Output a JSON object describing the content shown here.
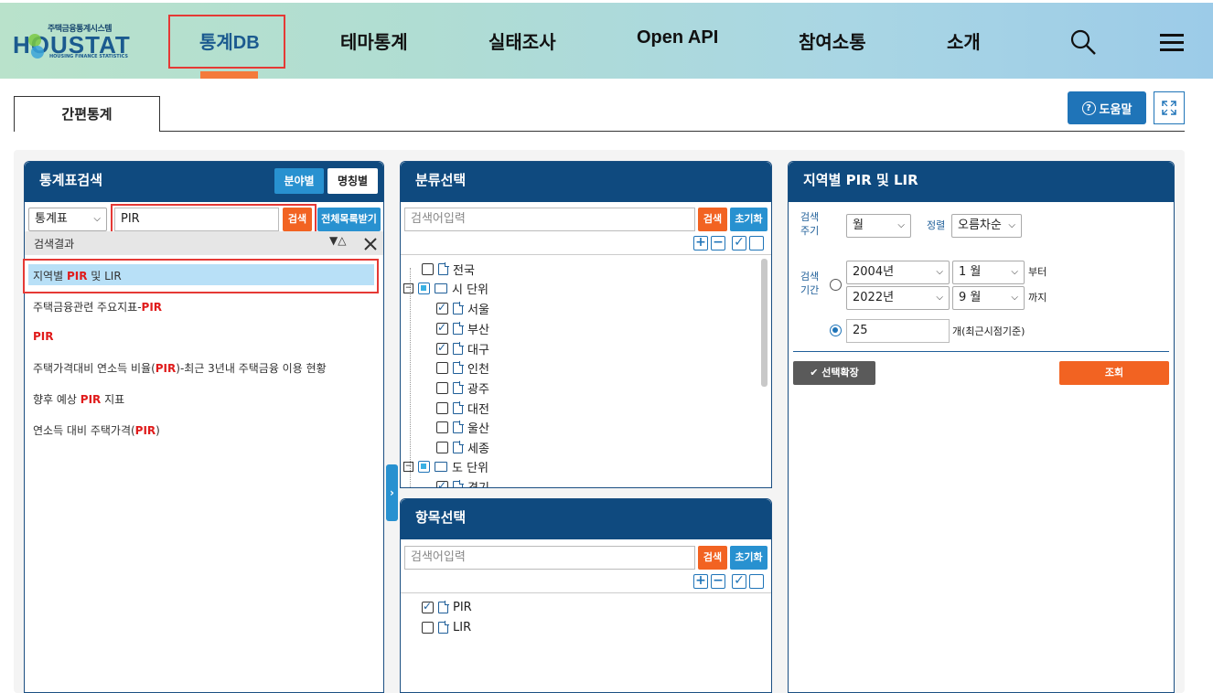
{
  "header": {
    "logo_sub": "주택금융통계시스템",
    "logo_main": "HOUSTAT",
    "logo_tag": "HOUSING FINANCE STATISTICS",
    "nav": [
      "통계DB",
      "테마통계",
      "실태조사",
      "Open API",
      "참여소통",
      "소개"
    ],
    "icons": [
      "search-icon",
      "menu-icon"
    ]
  },
  "tabs": {
    "active": "간편통계"
  },
  "toolbar": {
    "help_label": "도움말"
  },
  "left_panel": {
    "title": "통계표검색",
    "toggle": [
      "분야별",
      "명칭별"
    ],
    "filter_select": "통계표",
    "search_value": "PIR",
    "search_btn": "검색",
    "download_btn": "전체목록받기",
    "results_label": "검색결과",
    "sort_icons": "▼△",
    "results": [
      {
        "pre": "지역별 ",
        "hl": "PIR",
        "post": " 및 LIR"
      },
      {
        "pre": "주택금융관련 주요지표-",
        "hl": "PIR",
        "post": ""
      },
      {
        "pre": "",
        "hl": "PIR",
        "post": ""
      },
      {
        "pre": "주택가격대비 연소득 비율(",
        "hl": "PIR",
        "post": ")-최근 3년내 주택금융 이용 현황"
      },
      {
        "pre": "향후 예상 ",
        "hl": "PIR",
        "post": " 지표"
      },
      {
        "pre": "연소득 대비 주택가격(",
        "hl": "PIR",
        "post": ")"
      }
    ]
  },
  "category_panel": {
    "title": "분류선택",
    "search_placeholder": "검색어입력",
    "search_btn": "검색",
    "reset_btn": "초기화",
    "tree": [
      {
        "label": "전국",
        "level": 1,
        "type": "doc",
        "checked": false
      },
      {
        "label": "시 단위",
        "level": 0,
        "type": "folder",
        "checked": "partial"
      },
      {
        "label": "서울",
        "level": 2,
        "type": "doc",
        "checked": true
      },
      {
        "label": "부산",
        "level": 2,
        "type": "doc",
        "checked": true
      },
      {
        "label": "대구",
        "level": 2,
        "type": "doc",
        "checked": true
      },
      {
        "label": "인천",
        "level": 2,
        "type": "doc",
        "checked": false
      },
      {
        "label": "광주",
        "level": 2,
        "type": "doc",
        "checked": false
      },
      {
        "label": "대전",
        "level": 2,
        "type": "doc",
        "checked": false
      },
      {
        "label": "울산",
        "level": 2,
        "type": "doc",
        "checked": false
      },
      {
        "label": "세종",
        "level": 2,
        "type": "doc",
        "checked": false
      },
      {
        "label": "도 단위",
        "level": 0,
        "type": "folder",
        "checked": "partial"
      },
      {
        "label": "경기",
        "level": 2,
        "type": "doc",
        "checked": true
      }
    ]
  },
  "item_panel": {
    "title": "항목선택",
    "search_placeholder": "검색어입력",
    "search_btn": "검색",
    "reset_btn": "초기화",
    "tree": [
      {
        "label": "PIR",
        "checked": true
      },
      {
        "label": "LIR",
        "checked": false
      }
    ]
  },
  "right_panel": {
    "title": "지역별 PIR 및 LIR",
    "cycle_label": "검색 주기",
    "cycle_value": "월",
    "sort_label": "정렬",
    "sort_value": "오름차순",
    "period_label": "검색 기간",
    "from_year": "2004년",
    "from_month": "1 월",
    "from_suffix": "부터",
    "to_year": "2022년",
    "to_month": "9 월",
    "to_suffix": "까지",
    "recent_value": "25",
    "recent_suffix": "개(최근시점기준)",
    "expand_btn": "선택확장",
    "query_btn": "조회"
  }
}
